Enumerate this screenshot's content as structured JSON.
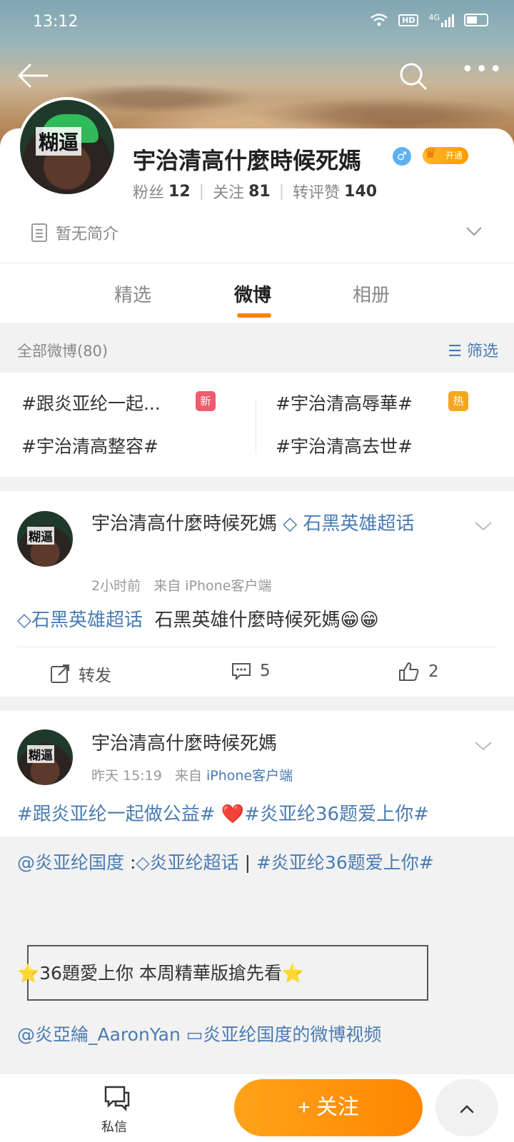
{
  "statusbar": {
    "time": "13:12",
    "network": "4G",
    "hd": "HD"
  },
  "profile": {
    "avatar_tag": "糊逼",
    "name": "宇治清高什麼時候死媽",
    "gender": "♂",
    "vip_label": "开通",
    "fans_label": "粉丝",
    "fans": "12",
    "follow_label": "关注",
    "follow": "81",
    "interactions_label": "转评赞",
    "interactions": "140",
    "bio": "暂无简介"
  },
  "tabs": [
    "精选",
    "微博",
    "相册"
  ],
  "filter": {
    "count": "全部微博(80)",
    "label": "筛选"
  },
  "topics": {
    "t1": "#跟炎亚纶一起...",
    "t1_badge": "新",
    "t2": "#宇治清高辱華#",
    "t2_badge": "热",
    "t3": "#宇治清高整容#",
    "t4": "#宇治清高去世#"
  },
  "post1": {
    "avatar_tag": "糊逼",
    "name": "宇治清高什麼時候死媽",
    "supertopic": "石黑英雄超话",
    "time": "2小时前",
    "source": "来自 iPhone客户端",
    "content_link": "石黑英雄超话",
    "content_text": "石黑英雄什麼時候死媽😁😁",
    "repost": "转发",
    "comments": "5",
    "likes": "2"
  },
  "post2": {
    "avatar_tag": "糊逼",
    "name": "宇治清高什麼時候死媽",
    "time": "昨天 15:19",
    "source_prefix": "来自",
    "source": "iPhone客户端",
    "content_a": "#跟炎亚纶一起做公益#",
    "content_heart": "❤️",
    "content_b": "#炎亚纶36题爱上你#",
    "repost_author": "@炎亚纶国度",
    "repost_colon": " :",
    "repost_supertopic": "炎亚纶超话",
    "repost_sep": " | ",
    "repost_topic": "#炎亚纶36题爱上你#",
    "frame_text": "⭐36題愛上你 本周精華版搶先看⭐",
    "footer_mention": "@炎亞綸_AaronYan",
    "footer_video": "炎亚纶国度的微博视频"
  },
  "bottombar": {
    "dm_label": "私信",
    "follow": "+ 关注"
  }
}
